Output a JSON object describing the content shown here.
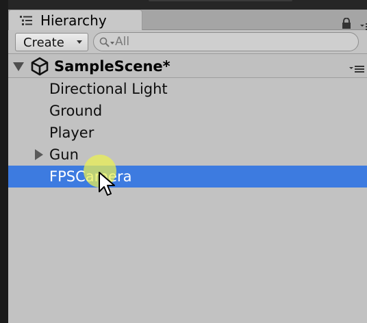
{
  "window": {
    "tab_title": "Hierarchy",
    "tab_icon": "list-hierarchy-icon",
    "lock_icon": "lock-icon",
    "panel_menu_icon": "menu-icon"
  },
  "toolbar": {
    "create_label": "Create",
    "create_caret_icon": "caret-down-icon",
    "search_icon": "search-icon",
    "search_placeholder": "All"
  },
  "scene": {
    "name": "SampleScene*",
    "icon": "unity-logo-icon",
    "expanded": true,
    "menu_icon": "menu-icon"
  },
  "items": [
    {
      "label": "Directional Light",
      "selected": false,
      "has_children": false
    },
    {
      "label": "Ground",
      "selected": false,
      "has_children": false
    },
    {
      "label": "Player",
      "selected": false,
      "has_children": false
    },
    {
      "label": "Gun",
      "selected": false,
      "has_children": true
    },
    {
      "label": "FPSCamera",
      "selected": true,
      "has_children": false
    }
  ],
  "colors": {
    "selection": "#3d7be0",
    "panel_background": "#c2c2c2",
    "cursor_highlight": "#ecf150"
  }
}
